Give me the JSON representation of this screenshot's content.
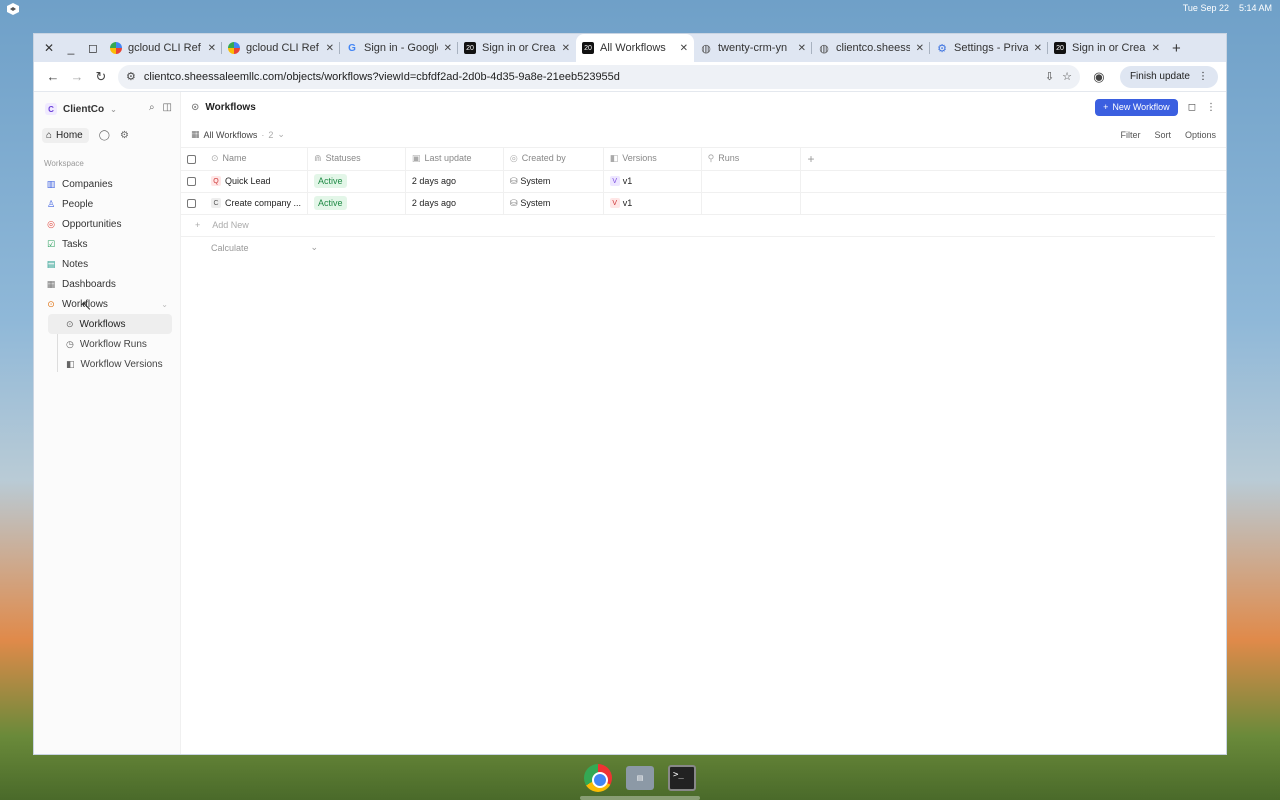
{
  "system": {
    "date": "Tue Sep 22",
    "time": "5:14 AM"
  },
  "browser": {
    "tabs": [
      {
        "title": "gcloud CLI Ref",
        "favicon": "gcloud-icon"
      },
      {
        "title": "gcloud CLI Ref",
        "favicon": "gcloud-icon"
      },
      {
        "title": "Sign in - Google",
        "favicon": "google-icon"
      },
      {
        "title": "Sign in or Crea",
        "favicon": "twenty-icon"
      },
      {
        "title": "All Workflows",
        "favicon": "twenty-icon",
        "active": true
      },
      {
        "title": "twenty-crm-yn",
        "favicon": "globe-icon"
      },
      {
        "title": "clientco.sheess",
        "favicon": "globe-icon"
      },
      {
        "title": "Settings - Priva",
        "favicon": "gear-icon"
      },
      {
        "title": "Sign in or Crea",
        "favicon": "twenty-icon"
      }
    ],
    "url": "clientco.sheessaleemllc.com/objects/workflows?viewId=cbfdf2ad-2d0b-4d35-9a8e-21eeb523955d",
    "finish_update": "Finish update"
  },
  "sidebar": {
    "workspace_name": "ClientCo",
    "workspace_initial": "C",
    "home": "Home",
    "section_label": "Workspace",
    "items": [
      {
        "label": "Companies",
        "icon": "building-icon",
        "color": "#3b5fe0"
      },
      {
        "label": "People",
        "icon": "person-icon",
        "color": "#3b5fe0"
      },
      {
        "label": "Opportunities",
        "icon": "target-icon",
        "color": "#e0453b"
      },
      {
        "label": "Tasks",
        "icon": "checkbox-icon",
        "color": "#1f9a55"
      },
      {
        "label": "Notes",
        "icon": "note-icon",
        "color": "#1f9a8a"
      },
      {
        "label": "Dashboards",
        "icon": "dashboard-icon",
        "color": "#777777"
      },
      {
        "label": "Workflows",
        "icon": "workflow-icon",
        "color": "#e07a1f"
      }
    ],
    "subitems": [
      {
        "label": "Workflows",
        "icon": "workflow-icon",
        "active": true
      },
      {
        "label": "Workflow Runs",
        "icon": "clock-icon"
      },
      {
        "label": "Workflow Versions",
        "icon": "versions-icon"
      }
    ]
  },
  "main": {
    "page_title": "Workflows",
    "new_button": "New Workflow",
    "view": {
      "name": "All Workflows",
      "count": "2"
    },
    "view_actions": [
      "Filter",
      "Sort",
      "Options"
    ],
    "columns": [
      "Name",
      "Statuses",
      "Last update",
      "Created by",
      "Versions",
      "Runs"
    ],
    "rows": [
      {
        "initial": "Q",
        "name": "Quick Lead",
        "status": "Active",
        "last_update": "2 days ago",
        "created_by": "System",
        "version_initial": "V",
        "version": "v1"
      },
      {
        "initial": "C",
        "name": "Create company ...",
        "status": "Active",
        "last_update": "2 days ago",
        "created_by": "System",
        "version_initial": "V",
        "version": "v1"
      }
    ],
    "add_new": "Add New",
    "calculate": "Calculate"
  }
}
